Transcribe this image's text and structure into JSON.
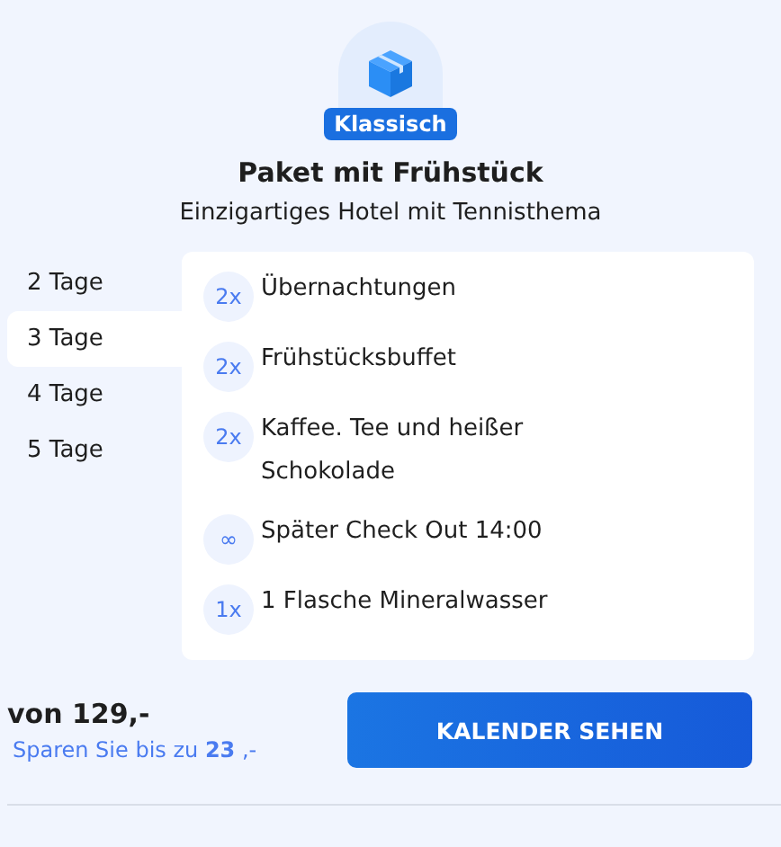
{
  "badge": "Klassisch",
  "title": "Paket mit Frühstück",
  "subtitle": "Einzigartiges Hotel mit Tennisthema",
  "durations": [
    {
      "label": "2 Tage",
      "selected": false
    },
    {
      "label": "3 Tage",
      "selected": true
    },
    {
      "label": "4 Tage",
      "selected": false
    },
    {
      "label": "5 Tage",
      "selected": false
    }
  ],
  "items": [
    {
      "qty": "2x",
      "text": "Übernachtungen"
    },
    {
      "qty": "2x",
      "text": "Frühstücksbuffet"
    },
    {
      "qty": "2x",
      "text": "Kaffee. Tee und heißer Schokolade"
    },
    {
      "qty": "∞",
      "text": "Später Check Out 14:00"
    },
    {
      "qty": "1x",
      "text": "1 Flasche Mineralwasser"
    }
  ],
  "price": "von 129,-",
  "savings": "Sparen Sie bis zu **23** ,-",
  "button": "KALENDER SEHEN"
}
